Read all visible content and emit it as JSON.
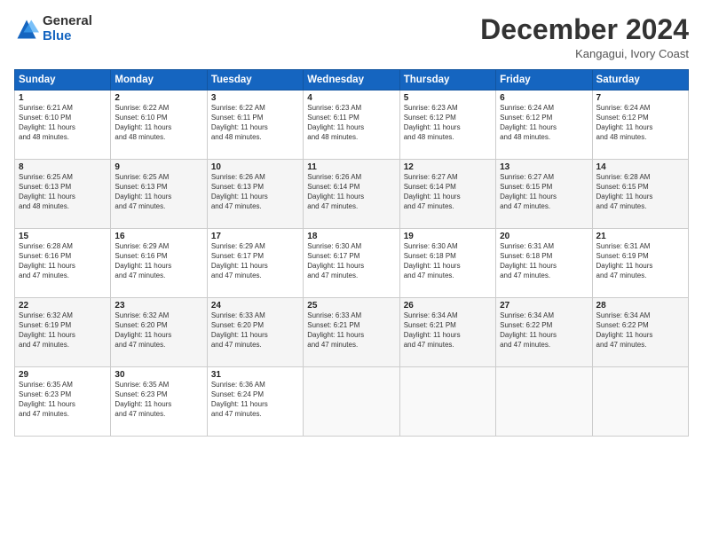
{
  "logo": {
    "general": "General",
    "blue": "Blue"
  },
  "title": "December 2024",
  "subtitle": "Kangagui, Ivory Coast",
  "days_header": [
    "Sunday",
    "Monday",
    "Tuesday",
    "Wednesday",
    "Thursday",
    "Friday",
    "Saturday"
  ],
  "weeks": [
    [
      {
        "day": "1",
        "text": "Sunrise: 6:21 AM\nSunset: 6:10 PM\nDaylight: 11 hours\nand 48 minutes."
      },
      {
        "day": "2",
        "text": "Sunrise: 6:22 AM\nSunset: 6:10 PM\nDaylight: 11 hours\nand 48 minutes."
      },
      {
        "day": "3",
        "text": "Sunrise: 6:22 AM\nSunset: 6:11 PM\nDaylight: 11 hours\nand 48 minutes."
      },
      {
        "day": "4",
        "text": "Sunrise: 6:23 AM\nSunset: 6:11 PM\nDaylight: 11 hours\nand 48 minutes."
      },
      {
        "day": "5",
        "text": "Sunrise: 6:23 AM\nSunset: 6:12 PM\nDaylight: 11 hours\nand 48 minutes."
      },
      {
        "day": "6",
        "text": "Sunrise: 6:24 AM\nSunset: 6:12 PM\nDaylight: 11 hours\nand 48 minutes."
      },
      {
        "day": "7",
        "text": "Sunrise: 6:24 AM\nSunset: 6:12 PM\nDaylight: 11 hours\nand 48 minutes."
      }
    ],
    [
      {
        "day": "8",
        "text": "Sunrise: 6:25 AM\nSunset: 6:13 PM\nDaylight: 11 hours\nand 48 minutes."
      },
      {
        "day": "9",
        "text": "Sunrise: 6:25 AM\nSunset: 6:13 PM\nDaylight: 11 hours\nand 47 minutes."
      },
      {
        "day": "10",
        "text": "Sunrise: 6:26 AM\nSunset: 6:13 PM\nDaylight: 11 hours\nand 47 minutes."
      },
      {
        "day": "11",
        "text": "Sunrise: 6:26 AM\nSunset: 6:14 PM\nDaylight: 11 hours\nand 47 minutes."
      },
      {
        "day": "12",
        "text": "Sunrise: 6:27 AM\nSunset: 6:14 PM\nDaylight: 11 hours\nand 47 minutes."
      },
      {
        "day": "13",
        "text": "Sunrise: 6:27 AM\nSunset: 6:15 PM\nDaylight: 11 hours\nand 47 minutes."
      },
      {
        "day": "14",
        "text": "Sunrise: 6:28 AM\nSunset: 6:15 PM\nDaylight: 11 hours\nand 47 minutes."
      }
    ],
    [
      {
        "day": "15",
        "text": "Sunrise: 6:28 AM\nSunset: 6:16 PM\nDaylight: 11 hours\nand 47 minutes."
      },
      {
        "day": "16",
        "text": "Sunrise: 6:29 AM\nSunset: 6:16 PM\nDaylight: 11 hours\nand 47 minutes."
      },
      {
        "day": "17",
        "text": "Sunrise: 6:29 AM\nSunset: 6:17 PM\nDaylight: 11 hours\nand 47 minutes."
      },
      {
        "day": "18",
        "text": "Sunrise: 6:30 AM\nSunset: 6:17 PM\nDaylight: 11 hours\nand 47 minutes."
      },
      {
        "day": "19",
        "text": "Sunrise: 6:30 AM\nSunset: 6:18 PM\nDaylight: 11 hours\nand 47 minutes."
      },
      {
        "day": "20",
        "text": "Sunrise: 6:31 AM\nSunset: 6:18 PM\nDaylight: 11 hours\nand 47 minutes."
      },
      {
        "day": "21",
        "text": "Sunrise: 6:31 AM\nSunset: 6:19 PM\nDaylight: 11 hours\nand 47 minutes."
      }
    ],
    [
      {
        "day": "22",
        "text": "Sunrise: 6:32 AM\nSunset: 6:19 PM\nDaylight: 11 hours\nand 47 minutes."
      },
      {
        "day": "23",
        "text": "Sunrise: 6:32 AM\nSunset: 6:20 PM\nDaylight: 11 hours\nand 47 minutes."
      },
      {
        "day": "24",
        "text": "Sunrise: 6:33 AM\nSunset: 6:20 PM\nDaylight: 11 hours\nand 47 minutes."
      },
      {
        "day": "25",
        "text": "Sunrise: 6:33 AM\nSunset: 6:21 PM\nDaylight: 11 hours\nand 47 minutes."
      },
      {
        "day": "26",
        "text": "Sunrise: 6:34 AM\nSunset: 6:21 PM\nDaylight: 11 hours\nand 47 minutes."
      },
      {
        "day": "27",
        "text": "Sunrise: 6:34 AM\nSunset: 6:22 PM\nDaylight: 11 hours\nand 47 minutes."
      },
      {
        "day": "28",
        "text": "Sunrise: 6:34 AM\nSunset: 6:22 PM\nDaylight: 11 hours\nand 47 minutes."
      }
    ],
    [
      {
        "day": "29",
        "text": "Sunrise: 6:35 AM\nSunset: 6:23 PM\nDaylight: 11 hours\nand 47 minutes."
      },
      {
        "day": "30",
        "text": "Sunrise: 6:35 AM\nSunset: 6:23 PM\nDaylight: 11 hours\nand 47 minutes."
      },
      {
        "day": "31",
        "text": "Sunrise: 6:36 AM\nSunset: 6:24 PM\nDaylight: 11 hours\nand 47 minutes."
      },
      {
        "day": "",
        "text": ""
      },
      {
        "day": "",
        "text": ""
      },
      {
        "day": "",
        "text": ""
      },
      {
        "day": "",
        "text": ""
      }
    ]
  ]
}
